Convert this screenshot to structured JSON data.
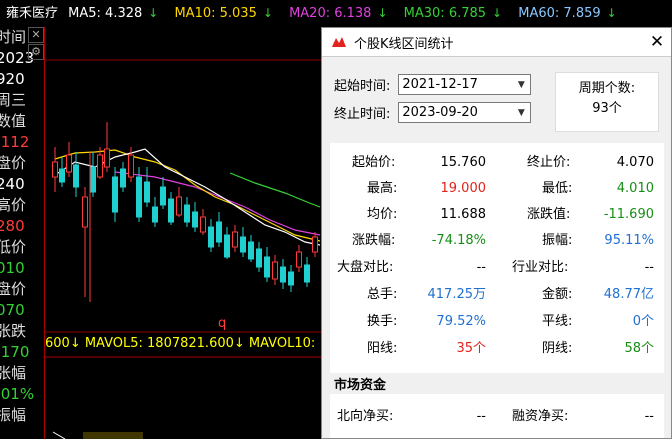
{
  "ma_bar": {
    "stock_name": "雍禾医疗",
    "ma5": "MA5: 4.328",
    "ma10": "MA10: 5.035",
    "ma20": "MA20: 6.138",
    "ma30": "MA30: 6.785",
    "ma60": "MA60: 7.859",
    "arrow": "↓"
  },
  "left_panel": {
    "rows": [
      {
        "text": "时间",
        "cls": "lbl"
      },
      {
        "text": "2023",
        "cls": "wt"
      },
      {
        "text": "920",
        "cls": "wt"
      },
      {
        "text": "周三",
        "cls": "lbl"
      },
      {
        "text": "数值",
        "cls": "lbl"
      },
      {
        "text": ".112",
        "cls": "up"
      },
      {
        "text": "盘价",
        "cls": "lbl"
      },
      {
        "text": "240",
        "cls": "wt"
      },
      {
        "text": "高价",
        "cls": "lbl"
      },
      {
        "text": "280",
        "cls": "up"
      },
      {
        "text": "低价",
        "cls": "lbl"
      },
      {
        "text": "010",
        "cls": "dn"
      },
      {
        "text": "盘价",
        "cls": "lbl"
      },
      {
        "text": "070",
        "cls": "dn"
      },
      {
        "text": "张跌",
        "cls": "lbl"
      },
      {
        "text": ".170",
        "cls": "dn"
      },
      {
        "text": "张幅",
        "cls": "lbl"
      },
      {
        "text": ".01%",
        "cls": "dn"
      },
      {
        "text": "振幅",
        "cls": "lbl"
      }
    ]
  },
  "chart": {
    "low_marker": "q"
  },
  "vol_bar": {
    "text": "600↓ MAVOL5: 1807821.600↓ MAVOL10:"
  },
  "dialog": {
    "title": "个股K线区间统计",
    "close": "✕",
    "start_label": "起始时间:",
    "start_value": "2021-12-17",
    "end_label": "终止时间:",
    "end_value": "2023-09-20",
    "period_label": "周期个数:",
    "period_value": "93个",
    "stats": {
      "start_price_label": "起始价:",
      "start_price": "15.760",
      "end_price_label": "终止价:",
      "end_price": "4.070",
      "high_label": "最高:",
      "high": "19.000",
      "low_label": "最低:",
      "low": "4.010",
      "avg_label": "均价:",
      "avg": "11.688",
      "change_label": "涨跌值:",
      "change": "-11.690",
      "pct_label": "涨跌幅:",
      "pct": "-74.18%",
      "amp_label": "振幅:",
      "amp": "95.11%",
      "market_label": "大盘对比:",
      "market": "--",
      "industry_label": "行业对比:",
      "industry": "--",
      "vol_label": "总手:",
      "vol": "417.25万",
      "amount_label": "金额:",
      "amount": "48.77亿",
      "turnover_label": "换手:",
      "turnover": "79.52%",
      "flat_label": "平线:",
      "flat": "0个",
      "yang_label": "阳线:",
      "yang": "35个",
      "yin_label": "阴线:",
      "yin": "58个"
    },
    "funds_title": "市场资金",
    "north_label": "北向净买:",
    "north": "--",
    "margin_label": "融资净买:",
    "margin": "--"
  }
}
